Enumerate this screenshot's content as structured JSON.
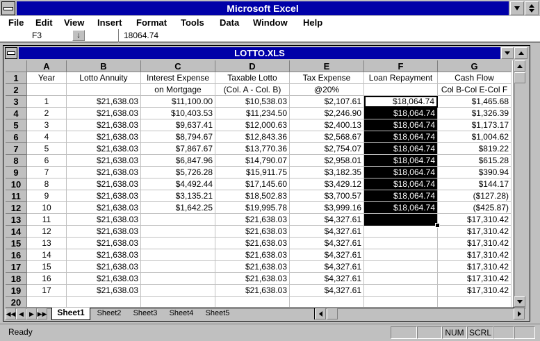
{
  "app": {
    "title": "Microsoft Excel"
  },
  "menu": [
    {
      "label": "File"
    },
    {
      "label": "Edit"
    },
    {
      "label": "View"
    },
    {
      "label": "Insert"
    },
    {
      "label": "Format"
    },
    {
      "label": "Tools"
    },
    {
      "label": "Data"
    },
    {
      "label": "Window"
    },
    {
      "label": "Help"
    }
  ],
  "formula_bar": {
    "cell_ref": "F3",
    "value": "18064.74"
  },
  "workbook": {
    "title": "LOTTO.XLS"
  },
  "columns": [
    "A",
    "B",
    "C",
    "D",
    "E",
    "F",
    "G"
  ],
  "rows": [
    [
      "Year",
      "Lotto Annuity",
      "Interest Expense",
      "Taxable Lotto",
      "Tax Expense",
      "Loan Repayment",
      "Cash Flow"
    ],
    [
      "",
      "",
      "on Mortgage",
      "(Col. A - Col. B)",
      "@20%",
      "",
      "Col B-Col E-Col F"
    ],
    [
      "1",
      "$21,638.03",
      "$11,100.00",
      "$10,538.03",
      "$2,107.61",
      "$18,064.74",
      "$1,465.68"
    ],
    [
      "2",
      "$21,638.03",
      "$10,403.53",
      "$11,234.50",
      "$2,246.90",
      "$18,064.74",
      "$1,326.39"
    ],
    [
      "3",
      "$21,638.03",
      "$9,637.41",
      "$12,000.63",
      "$2,400.13",
      "$18,064.74",
      "$1,173.17"
    ],
    [
      "4",
      "$21,638.03",
      "$8,794.67",
      "$12,843.36",
      "$2,568.67",
      "$18,064.74",
      "$1,004.62"
    ],
    [
      "5",
      "$21,638.03",
      "$7,867.67",
      "$13,770.36",
      "$2,754.07",
      "$18,064.74",
      "$819.22"
    ],
    [
      "6",
      "$21,638.03",
      "$6,847.96",
      "$14,790.07",
      "$2,958.01",
      "$18,064.74",
      "$615.28"
    ],
    [
      "7",
      "$21,638.03",
      "$5,726.28",
      "$15,911.75",
      "$3,182.35",
      "$18,064.74",
      "$390.94"
    ],
    [
      "8",
      "$21,638.03",
      "$4,492.44",
      "$17,145.60",
      "$3,429.12",
      "$18,064.74",
      "$144.17"
    ],
    [
      "9",
      "$21,638.03",
      "$3,135.21",
      "$18,502.83",
      "$3,700.57",
      "$18,064.74",
      "($127.28)"
    ],
    [
      "10",
      "$21,638.03",
      "$1,642.25",
      "$19,995.78",
      "$3,999.16",
      "$18,064.74",
      "($425.87)"
    ],
    [
      "11",
      "$21,638.03",
      "",
      "$21,638.03",
      "$4,327.61",
      "",
      "$17,310.42"
    ],
    [
      "12",
      "$21,638.03",
      "",
      "$21,638.03",
      "$4,327.61",
      "",
      "$17,310.42"
    ],
    [
      "13",
      "$21,638.03",
      "",
      "$21,638.03",
      "$4,327.61",
      "",
      "$17,310.42"
    ],
    [
      "14",
      "$21,638.03",
      "",
      "$21,638.03",
      "$4,327.61",
      "",
      "$17,310.42"
    ],
    [
      "15",
      "$21,638.03",
      "",
      "$21,638.03",
      "$4,327.61",
      "",
      "$17,310.42"
    ],
    [
      "16",
      "$21,638.03",
      "",
      "$21,638.03",
      "$4,327.61",
      "",
      "$17,310.42"
    ],
    [
      "17",
      "$21,638.03",
      "",
      "$21,638.03",
      "$4,327.61",
      "",
      "$17,310.42"
    ],
    [
      "",
      "",
      "",
      "",
      "",
      "",
      ""
    ]
  ],
  "sheet_tabs": [
    "Sheet1",
    "Sheet2",
    "Sheet3",
    "Sheet4",
    "Sheet5"
  ],
  "active_tab": "Sheet1",
  "status": {
    "text": "Ready",
    "num": "NUM",
    "scrl": "SCRL"
  },
  "colors": {
    "title_bar": "#0000a8",
    "workbook_title": "#0000a8",
    "selection": "#000000"
  }
}
